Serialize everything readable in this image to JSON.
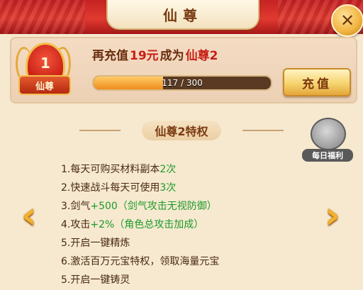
{
  "header": {
    "title": "仙尊"
  },
  "close_icon": "close-icon",
  "vip": {
    "level": "1",
    "rank_label": "仙尊",
    "recharge_message": {
      "prefix": "再充值",
      "amount": "19元",
      "middle": "成为",
      "target": "仙尊2"
    },
    "progress": {
      "current": 117,
      "max": 300,
      "text": "117 / 300"
    },
    "recharge_button": "充值"
  },
  "privileges": {
    "title": "仙尊2特权",
    "items": [
      {
        "num": "1.",
        "text": "每天可购买材料副本",
        "highlight": "2次"
      },
      {
        "num": "2.",
        "text": "快速战斗每天可使用",
        "highlight": "3次"
      },
      {
        "num": "3.",
        "text": "剑气",
        "highlight": "+500（剑气攻击无视防御）"
      },
      {
        "num": "4.",
        "text": "攻击",
        "highlight": "+2%（角色总攻击加成）"
      },
      {
        "num": "5.",
        "text": "开启一键精炼",
        "highlight": ""
      },
      {
        "num": "6.",
        "text": "激活百万元宝特权，领取海量元宝",
        "highlight": ""
      },
      {
        "num": "5.",
        "text": "开启一键铸灵",
        "highlight": ""
      }
    ]
  },
  "daily_benefit": {
    "label": "每日福利",
    "icon": "treasure-icon"
  },
  "nav": {
    "prev": "‹",
    "next": "›"
  },
  "colors": {
    "header_red": "#d42a22",
    "accent_gold": "#f3b02b",
    "highlight_green": "#1c9a2a"
  }
}
